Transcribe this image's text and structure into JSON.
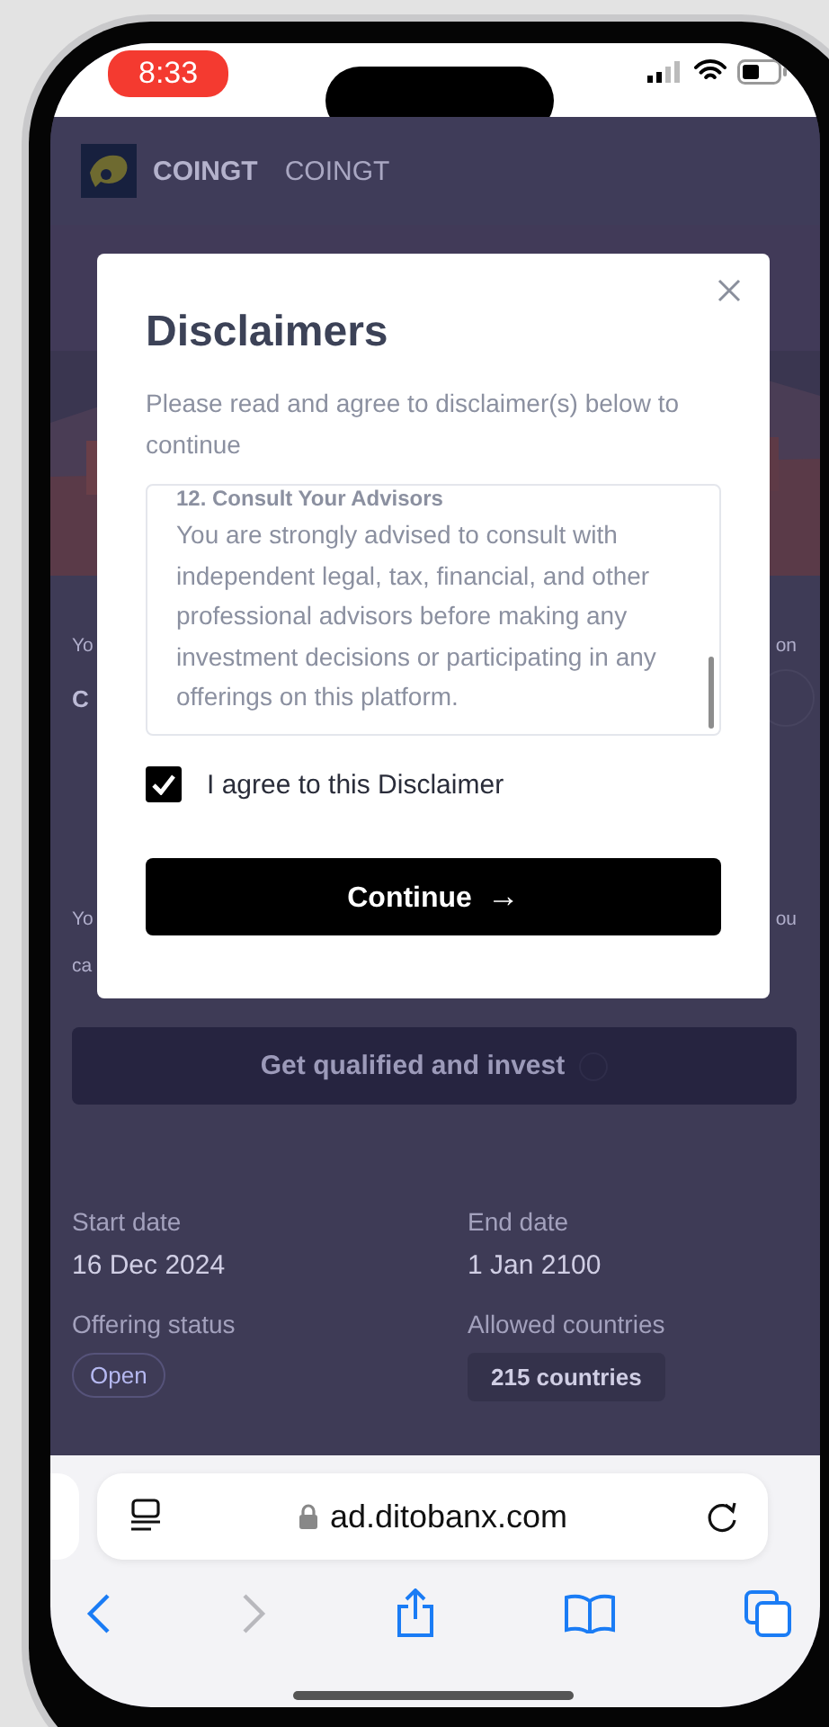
{
  "status_bar": {
    "time": "8:33"
  },
  "header": {
    "brand": "COINGT",
    "name": "COINGT"
  },
  "behind_modal": {
    "line_1_left": "Yo",
    "line_1_right": "on",
    "line_2_left": "C",
    "line_3_left": "Yo",
    "line_3_right": "ou",
    "line_4_left": "ca"
  },
  "cta_button": {
    "label": "Get qualified and invest"
  },
  "details": [
    {
      "label": "Start date",
      "value": "16 Dec 2024",
      "kind": "text"
    },
    {
      "label": "End date",
      "value": "1 Jan 2100",
      "kind": "text"
    },
    {
      "label": "Offering status",
      "value": "Open",
      "kind": "badge"
    },
    {
      "label": "Allowed countries",
      "value": "215 countries",
      "kind": "chip"
    }
  ],
  "modal": {
    "title": "Disclaimers",
    "subtitle": "Please read and agree to disclaimer(s) below to continue",
    "disclaimer_heading": "12. Consult Your Advisors",
    "disclaimer_text": "You are strongly advised to consult with independent legal, tax, financial, and other professional advisors before making any investment decisions or participating in any offerings on this platform.",
    "agree": {
      "label": "I agree to this Disclaimer",
      "checked": true
    },
    "continue_button": "Continue",
    "continue_arrow": "→"
  },
  "browser": {
    "url": "ad.ditobanx.com"
  }
}
